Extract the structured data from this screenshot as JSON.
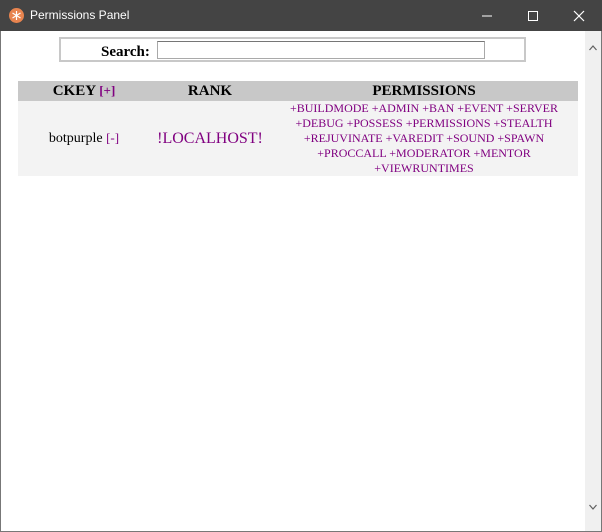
{
  "window": {
    "title": "Permissions Panel",
    "icon": "app-logo-icon",
    "controls": [
      "minimize-icon",
      "maximize-icon",
      "close-icon"
    ]
  },
  "search": {
    "label": "Search:",
    "value": ""
  },
  "table": {
    "headers": {
      "ckey": "CKEY",
      "ckey_add": "[+]",
      "rank": "RANK",
      "permissions": "PERMISSIONS"
    },
    "rows": [
      {
        "ckey": "botpurple",
        "remove": "[-]",
        "rank": "!LOCALHOST!",
        "permissions": [
          "+BUILDMODE",
          "+ADMIN",
          "+BAN",
          "+EVENT",
          "+SERVER",
          "+DEBUG",
          "+POSSESS",
          "+PERMISSIONS",
          "+STEALTH",
          "+REJUVINATE",
          "+VAREDIT",
          "+SOUND",
          "+SPAWN",
          "+PROCCALL",
          "+MODERATOR",
          "+MENTOR",
          "+VIEWRUNTIMES"
        ]
      }
    ]
  },
  "colors": {
    "titlebar": "#444444",
    "link": "#800080",
    "header_bg": "#c8c8c8",
    "row_bg": "#f3f3f3"
  }
}
